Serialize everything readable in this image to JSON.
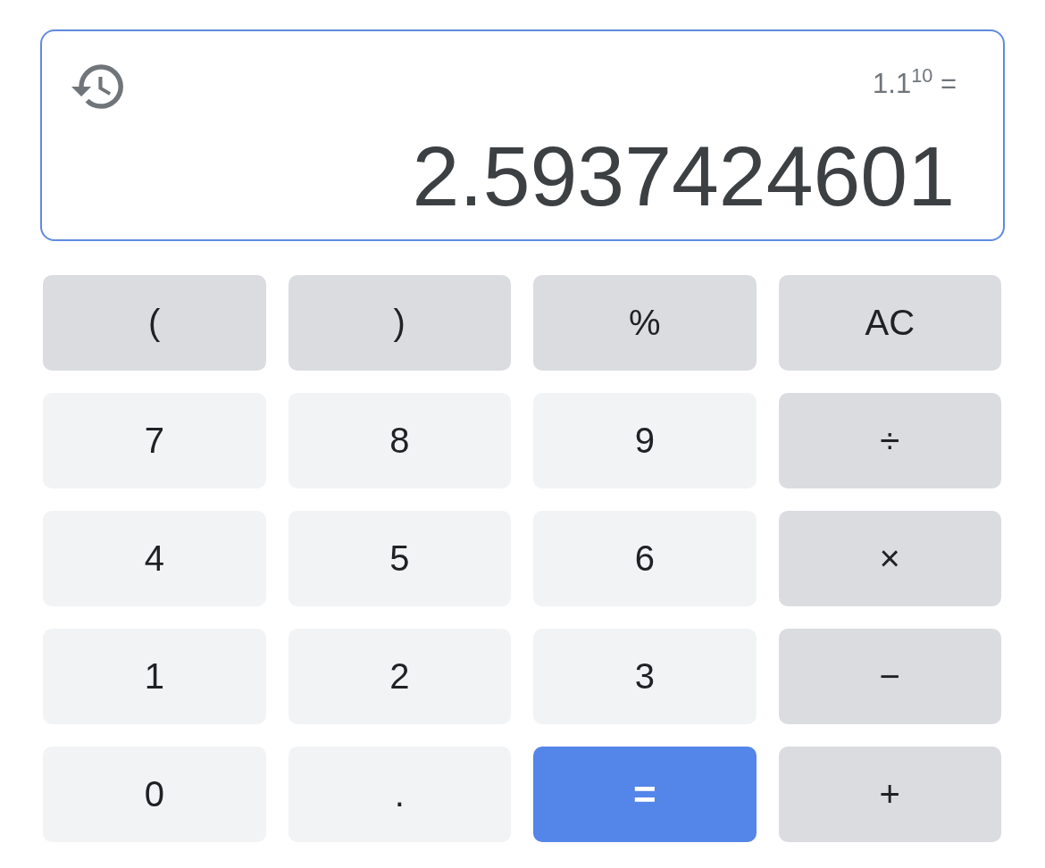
{
  "display": {
    "expression": "1.1$^{10}$ =",
    "result": "2.5937424601"
  },
  "keys": [
    {
      "label": "(",
      "kind": "function"
    },
    {
      "label": ")",
      "kind": "function"
    },
    {
      "label": "%",
      "kind": "function"
    },
    {
      "label": "AC",
      "kind": "function"
    },
    {
      "label": "7",
      "kind": "digit"
    },
    {
      "label": "8",
      "kind": "digit"
    },
    {
      "label": "9",
      "kind": "digit"
    },
    {
      "label": "÷",
      "kind": "function"
    },
    {
      "label": "4",
      "kind": "digit"
    },
    {
      "label": "5",
      "kind": "digit"
    },
    {
      "label": "6",
      "kind": "digit"
    },
    {
      "label": "×",
      "kind": "function"
    },
    {
      "label": "1",
      "kind": "digit"
    },
    {
      "label": "2",
      "kind": "digit"
    },
    {
      "label": "3",
      "kind": "digit"
    },
    {
      "label": "−",
      "kind": "function"
    },
    {
      "label": "0",
      "kind": "digit"
    },
    {
      "label": ".",
      "kind": "digit"
    },
    {
      "label": "=",
      "kind": "equals"
    },
    {
      "label": "+",
      "kind": "function"
    }
  ]
}
